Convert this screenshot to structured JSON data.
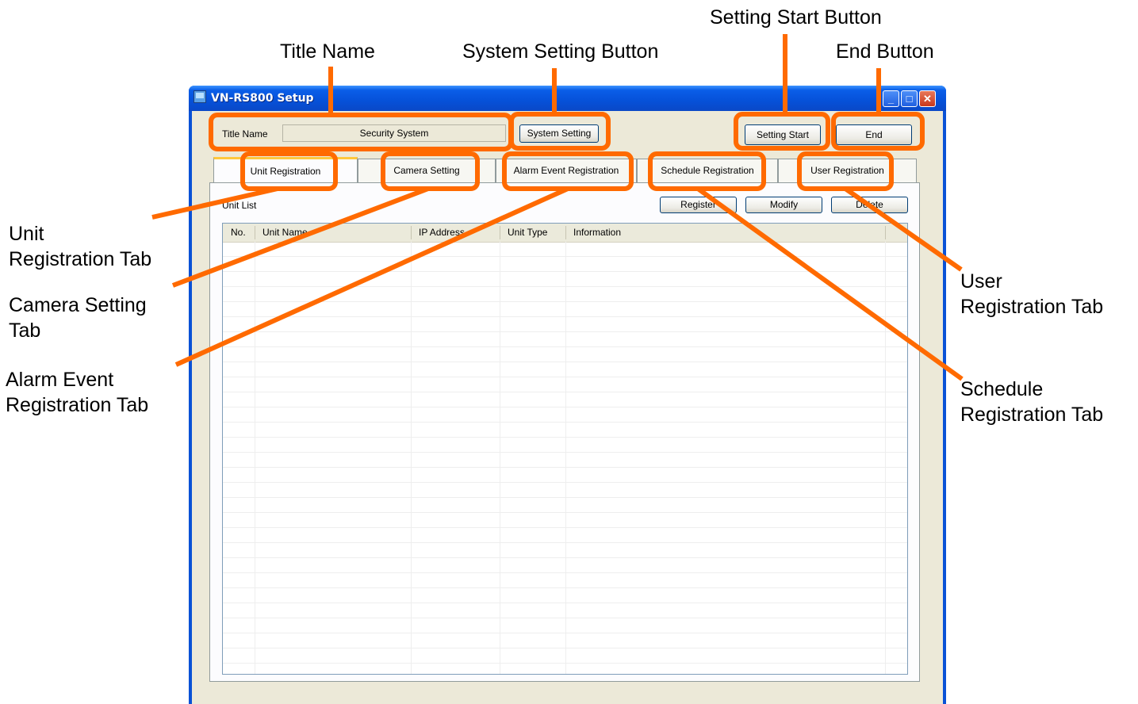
{
  "window": {
    "title": "VN-RS800 Setup",
    "controls": [
      "minimize-icon",
      "maximize-icon",
      "close-icon"
    ],
    "accent": "#0a52d6"
  },
  "title_row": {
    "label": "Title Name",
    "value": "Security System",
    "system_setting_label": "System Setting",
    "setting_start_label": "Setting Start",
    "end_label": "End"
  },
  "tabs": [
    {
      "label": "Unit Registration",
      "active": true
    },
    {
      "label": "Camera Setting",
      "active": false
    },
    {
      "label": "Alarm Event Registration",
      "active": false
    },
    {
      "label": "Schedule Registration",
      "active": false
    },
    {
      "label": "User Registration",
      "active": false
    }
  ],
  "unit_list": {
    "label": "Unit List",
    "register_label": "Register",
    "modify_label": "Modify",
    "delete_label": "Delete",
    "columns": [
      "No.",
      "Unit Name",
      "IP Address",
      "Unit Type",
      "Information"
    ]
  },
  "callouts": {
    "title_name": "Title  Name",
    "system_setting_button": "System Setting Button",
    "setting_start_button": "Setting Start Button",
    "end_button": "End Button",
    "unit_registration_tab": [
      "Unit",
      "Registration  Tab"
    ],
    "camera_setting_tab": [
      "Camera Setting",
      "Tab"
    ],
    "alarm_event_registration_tab": [
      "Alarm Event",
      "Registration Tab"
    ],
    "user_registration_tab": [
      "User",
      "Registration Tab"
    ],
    "schedule_registration_tab": [
      "Schedule",
      "Registration Tab"
    ]
  },
  "annotation_color": "#ff6a00"
}
